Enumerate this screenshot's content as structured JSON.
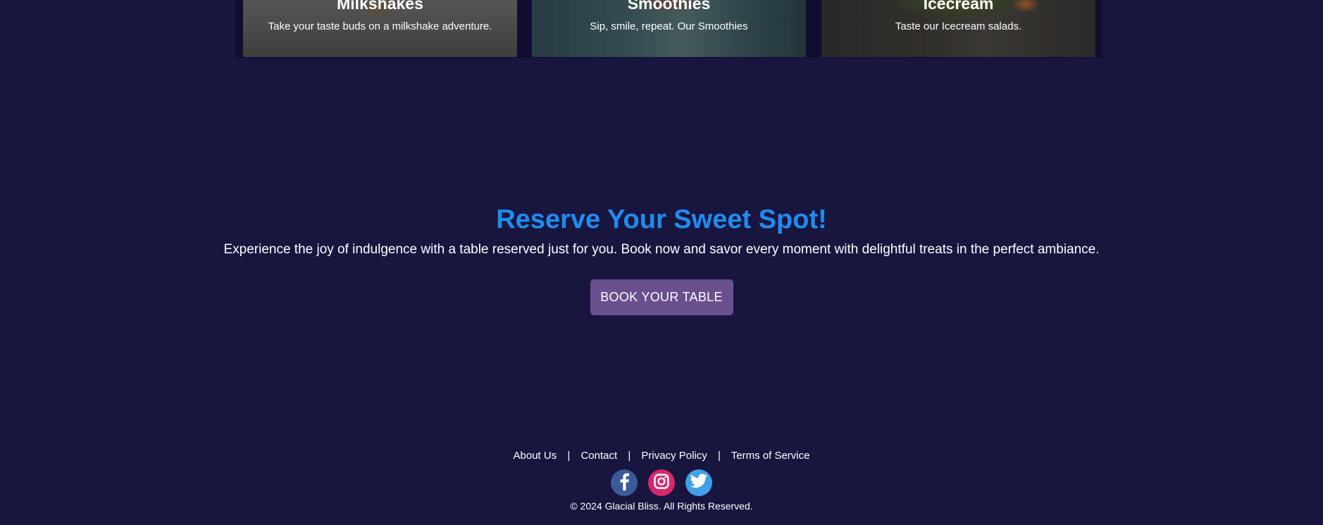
{
  "cards": [
    {
      "title": "Milkshakes",
      "text": "Take your taste buds on a milkshake adventure."
    },
    {
      "title": "Smoothies",
      "text": "Sip, smile, repeat. Our Smoothies"
    },
    {
      "title": "Icecream",
      "text": "Taste our Icecream salads."
    }
  ],
  "reserve": {
    "title": "Reserve Your Sweet Spot!",
    "text": "Experience the joy of indulgence with a table reserved just for you. Book now and savor every moment with delightful treats in the perfect ambiance.",
    "button_label": "BOOK YOUR TABLE"
  },
  "footer": {
    "links": [
      "About Us",
      "Contact",
      "Privacy Policy",
      "Terms of Service"
    ],
    "separator": "|",
    "social": [
      {
        "name": "facebook-icon",
        "color": "#3b5a9a"
      },
      {
        "name": "instagram-icon",
        "color": "#d6286d"
      },
      {
        "name": "twitter-icon",
        "color": "#3fa0e8"
      }
    ],
    "copyright": "© 2024 Glacial Bliss. All Rights Reserved."
  },
  "colors": {
    "page_background": "#18163f",
    "accent_title": "#1e8cf0",
    "button": "#6a4f8f"
  }
}
